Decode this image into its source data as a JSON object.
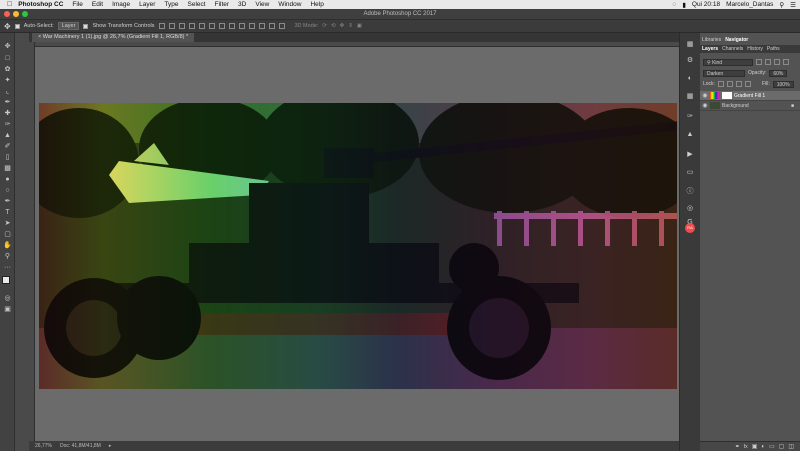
{
  "menubar": {
    "apple_icon": "apple-icon",
    "app_name": "Photoshop CC",
    "items": [
      "File",
      "Edit",
      "Image",
      "Layer",
      "Type",
      "Select",
      "Filter",
      "3D",
      "View",
      "Window",
      "Help"
    ],
    "clock": "Qui 20:18",
    "user": "Marcelo_Dantas"
  },
  "titlebar": {
    "title": "Adobe Photoshop CC 2017"
  },
  "options": {
    "auto_select": "Auto-Select:",
    "auto_select_value": "Layer",
    "show_transform": "Show Transform Controls",
    "mode_3d": "3D Mode:"
  },
  "document": {
    "tab_title": "War Machinery 1 (1).jpg @ 26,7% (Gradient Fill 1, RGB/8) *",
    "zoom": "26,77%",
    "doc_info": "Doc: 41,8M/41,8M"
  },
  "panel": {
    "top_tabs": [
      "Libraries",
      "Navigator"
    ],
    "tabs": [
      "Layers",
      "Channels",
      "History",
      "Paths"
    ],
    "filter_kind": "Kind",
    "blend_mode": "Darken",
    "opacity_label": "Opacity:",
    "opacity": "60%",
    "lock_label": "Lock:",
    "fill_label": "Fill:",
    "fill": "100%",
    "layers": [
      {
        "name": "Gradient Fill 1",
        "selected": true
      },
      {
        "name": "Background",
        "selected": false
      }
    ]
  },
  "colors": {
    "accent": "#31a8ff",
    "gradient": [
      "#ff1f1f",
      "#f6e400",
      "#19d819",
      "#0fb3a8",
      "#1e3cc8",
      "#a212c9",
      "#ff1aa8",
      "#ff2020"
    ]
  }
}
